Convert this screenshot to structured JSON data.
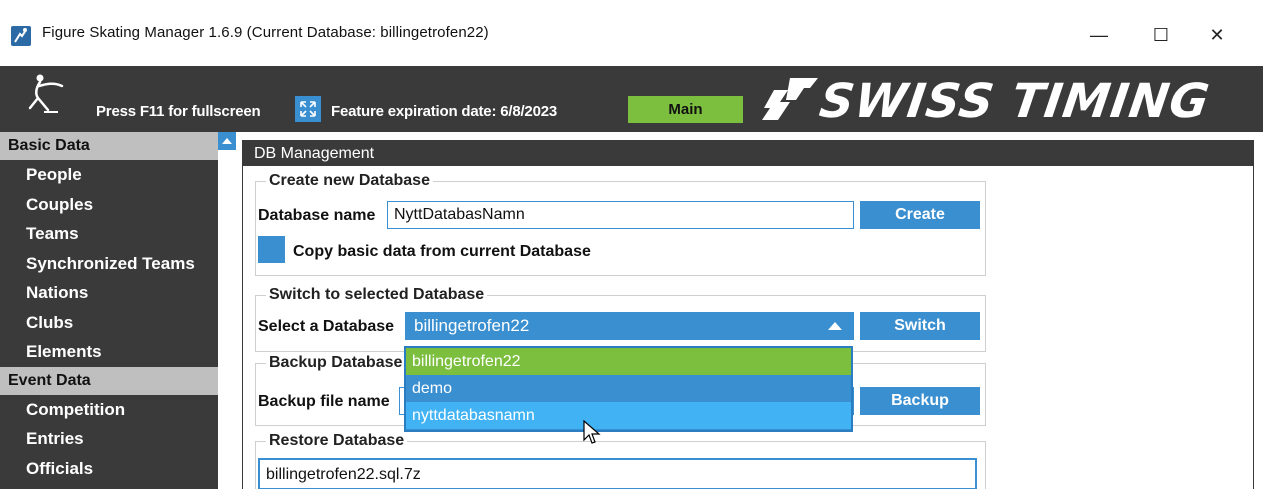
{
  "window": {
    "title": "Figure Skating Manager 1.6.9 (Current Database: billingetrofen22)",
    "minimize_glyph": "—",
    "maximize_glyph": "☐",
    "close_glyph": "✕"
  },
  "header": {
    "fullscreen_hint": "Press F11 for fullscreen",
    "expiration": "Feature expiration date: 6/8/2023",
    "main_button": "Main",
    "brand": "SWISS TIMING"
  },
  "sidebar": {
    "sections": [
      {
        "label": "Basic Data",
        "items": [
          "People",
          "Couples",
          "Teams",
          "Synchronized Teams",
          "Nations",
          "Clubs",
          "Elements"
        ]
      },
      {
        "label": "Event Data",
        "items": [
          "Competition",
          "Entries",
          "Officials"
        ]
      }
    ]
  },
  "panel": {
    "title": "DB Management",
    "create": {
      "legend": "Create new Database",
      "name_label": "Database name",
      "name_value": "NyttDatabasNamn",
      "create_button": "Create",
      "copy_label": "Copy basic data from current Database"
    },
    "switch": {
      "legend": "Switch to selected Database",
      "select_label": "Select a Database",
      "selected_value": "billingetrofen22",
      "switch_button": "Switch",
      "options": [
        "billingetrofen22",
        "demo",
        "nyttdatabasnamn"
      ]
    },
    "backup": {
      "legend": "Backup Database",
      "file_label": "Backup file name",
      "backup_button": "Backup"
    },
    "restore": {
      "legend": "Restore Database",
      "file_value": "billingetrofen22.sql.7z"
    }
  },
  "colors": {
    "dark": "#3a3a3a",
    "accent_blue": "#3a8fd0",
    "accent_green": "#7cbf3f",
    "hover_blue": "#41b3f5"
  }
}
